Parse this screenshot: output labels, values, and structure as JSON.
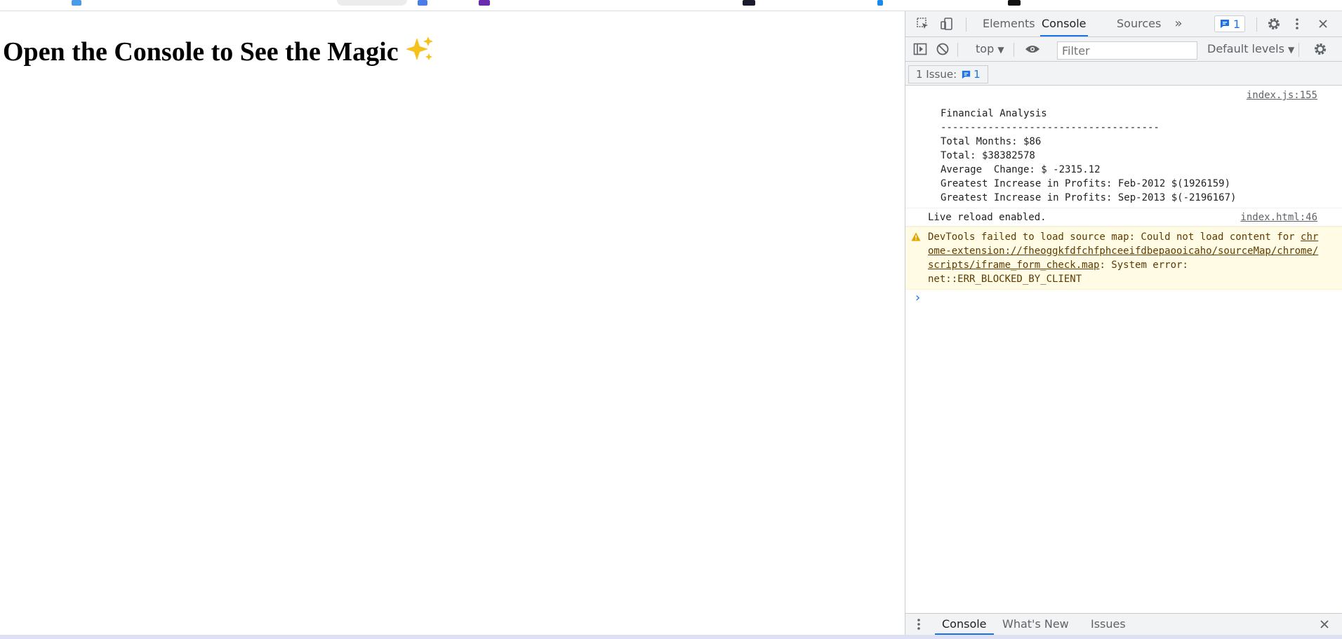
{
  "page": {
    "title": "Open the Console to See the Magic"
  },
  "devtools": {
    "tabs": [
      {
        "label": "Elements"
      },
      {
        "label": "Console"
      },
      {
        "label": "Sources"
      }
    ],
    "issue_count": "1",
    "toolbar": {
      "context": "top",
      "filter_placeholder": "Filter",
      "levels": "Default levels"
    },
    "issues_bar": {
      "label": "1 Issue:",
      "count": "1"
    },
    "console": {
      "log_source": "index.js:155",
      "log_lines": [
        "Financial Analysis",
        "-------------------------------------",
        "Total Months: $86",
        "Total: $38382578",
        "Average  Change: $ -2315.12",
        "Greatest Increase in Profits: Feb-2012 $(1926159)",
        "Greatest Increase in Profits: Sep-2013 $(-2196167)"
      ],
      "live_reload": "Live reload enabled.",
      "live_reload_source": "index.html:46",
      "warning_prefix": "DevTools failed to load source map: Could not load content for ",
      "warning_link": "chrome-extension://fheoggkfdfchfphceeifdbepaooicaho/sourceMap/chrome/scripts/iframe_form_check.map",
      "warning_suffix": ": System error: net::ERR_BLOCKED_BY_CLIENT"
    },
    "drawer_tabs": [
      {
        "label": "Console"
      },
      {
        "label": "What's New"
      },
      {
        "label": "Issues"
      }
    ]
  },
  "colors": {
    "accent": "#1a73e8",
    "warning_bg": "#fffbe5",
    "toolbar_bg": "#f1f3f4"
  }
}
